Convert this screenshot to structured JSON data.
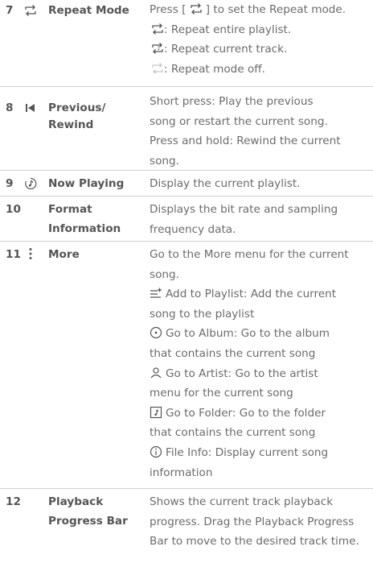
{
  "rows": [
    {
      "number": "7",
      "icon": "repeat-icon",
      "name_lines": [
        "Repeat Mode"
      ],
      "desc": {
        "line0_a": "Press [",
        "line0_b": "] to set the Repeat mode.",
        "line1": ": Repeat entire playlist.",
        "line2": ": Repeat current track.",
        "line3": ": Repeat mode off."
      }
    },
    {
      "number": "8",
      "icon": "previous-rewind-icon",
      "name_lines": [
        "Previous/",
        "Rewind"
      ],
      "desc_lines": [
        "Short press: Play the previous",
        "song or restart the current song.",
        "Press and hold: Rewind the current",
        "song."
      ]
    },
    {
      "number": "9",
      "icon": "now-playing-icon",
      "name_lines": [
        "Now Playing"
      ],
      "desc_lines": [
        "Display the current playlist."
      ]
    },
    {
      "number": "10",
      "icon": "",
      "name_lines": [
        "Format",
        "Information"
      ],
      "desc_lines": [
        "Displays the bit rate and sampling",
        "frequency data."
      ]
    },
    {
      "number": "11",
      "icon": "more-icon",
      "name_lines": [
        "More"
      ],
      "desc_lines": [
        "Go to the More menu for the current",
        "song.",
        "Add to Playlist: Add the current",
        "song to the playlist",
        "Go to Album: Go to the album",
        "that contains the current song",
        "Go to Artist: Go to the artist",
        "menu for the current song",
        "Go to Folder: Go to the folder",
        "that contains the current song",
        "File Info: Display current song",
        "information"
      ],
      "inline_icons": [
        "add-to-playlist-icon",
        "album-icon",
        "artist-icon",
        "folder-icon",
        "info-icon"
      ]
    },
    {
      "number": "12",
      "icon": "",
      "name_lines": [
        "Playback",
        "Progress Bar"
      ],
      "desc_lines": [
        "Shows the current track playback",
        "progress. Drag the Playback Progress",
        "Bar to move to the desired track time."
      ]
    }
  ],
  "colors": {
    "text": "#6b6b6b",
    "heading": "#555555",
    "divider": "#cfcfcf",
    "icon_dim": "#c8c8c8"
  }
}
